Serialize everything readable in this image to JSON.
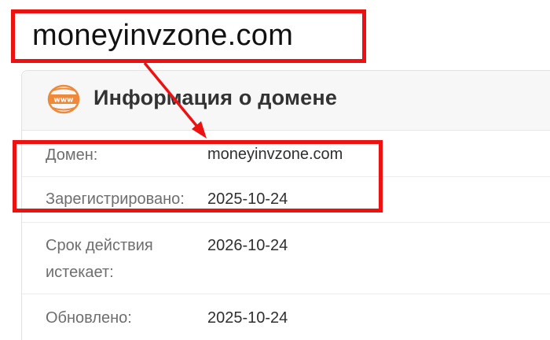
{
  "callout": {
    "text": "moneyinvzone.com"
  },
  "card": {
    "icon": "www-icon",
    "title": "Информация о домене",
    "rows": [
      {
        "label": "Домен:",
        "value": "moneyinvzone.com"
      },
      {
        "label": "Зарегистрировано:",
        "value": "2025-10-24"
      },
      {
        "label": "Срок действия истекает:",
        "value": "2026-10-24"
      },
      {
        "label": "Обновлено:",
        "value": "2025-10-24"
      }
    ]
  },
  "colors": {
    "annotation_red": "#ee1111",
    "icon_orange": "#f0883a",
    "header_bg": "#f7f7f7"
  }
}
